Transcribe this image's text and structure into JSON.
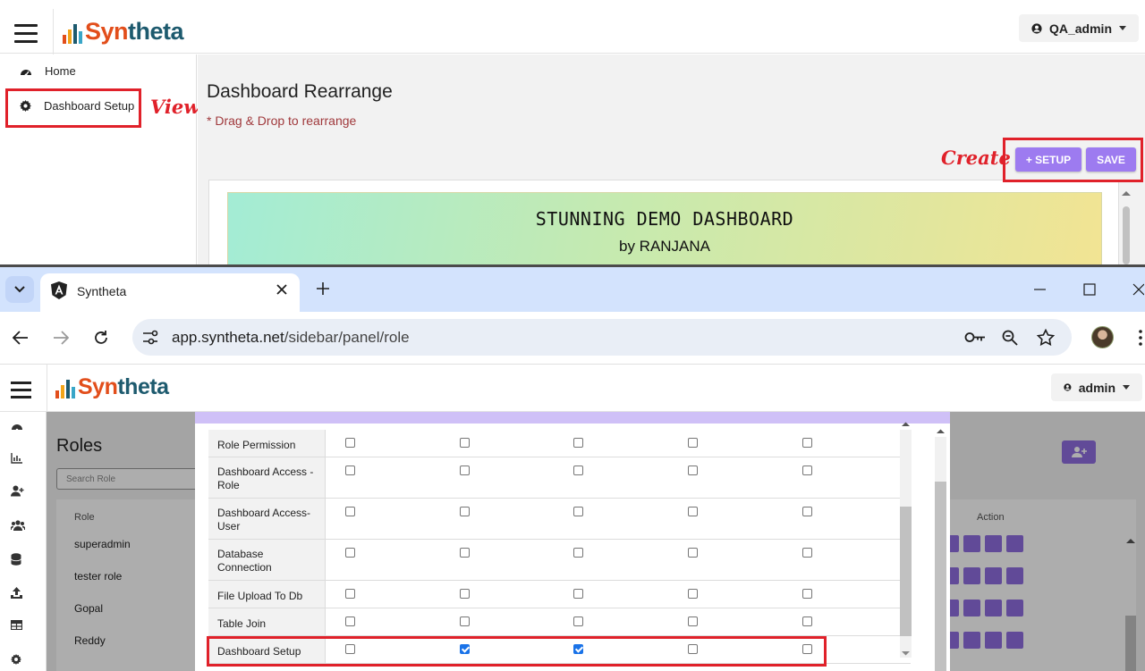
{
  "top_app": {
    "logo": {
      "part1": "Syn",
      "part2": "theta"
    },
    "user": "QA_admin",
    "sidebar": [
      {
        "label": "Home",
        "icon": "dashboard-gauge-icon"
      },
      {
        "label": "Dashboard Setup",
        "icon": "gear-icon"
      }
    ],
    "annotation_view": "View",
    "annotation_create": "Create",
    "page_title": "Dashboard Rearrange",
    "hint": "* Drag & Drop to rearrange",
    "buttons": {
      "setup": "+ SETUP",
      "save": "SAVE"
    },
    "banner": {
      "title": "STUNNING DEMO DASHBOARD",
      "subtitle": "by RANJANA"
    }
  },
  "browser": {
    "tab_title": "Syntheta",
    "url_host": "app.syntheta.net",
    "url_path": "/sidebar/panel/role"
  },
  "bottom_app": {
    "logo": {
      "part1": "Syn",
      "part2": "theta"
    },
    "user": "admin",
    "page_title": "Roles",
    "search_placeholder": "Search Role",
    "table_headers": {
      "role": "Role",
      "action": "Action"
    },
    "roles": [
      "superadmin",
      "tester role",
      "Gopal",
      "Reddy"
    ],
    "sidebar_icons": [
      "dashboard-gauge-icon",
      "chart-icon",
      "user-icon",
      "users-icon",
      "database-icon",
      "upload-icon",
      "table-icon",
      "gear-icon"
    ],
    "permissions_modal": {
      "rows": [
        {
          "label": "Role Permission",
          "checks": [
            false,
            false,
            false,
            false,
            false
          ]
        },
        {
          "label": "Dashboard Access - Role",
          "checks": [
            false,
            false,
            false,
            false,
            false
          ]
        },
        {
          "label": "Dashboard Access-User",
          "checks": [
            false,
            false,
            false,
            false,
            false
          ]
        },
        {
          "label": "Database Connection",
          "checks": [
            false,
            false,
            false,
            false,
            false
          ]
        },
        {
          "label": "File Upload To Db",
          "checks": [
            false,
            false,
            false,
            false,
            false
          ]
        },
        {
          "label": "Table Join",
          "checks": [
            false,
            false,
            false,
            false,
            false
          ]
        },
        {
          "label": "Dashboard Setup",
          "checks": [
            false,
            true,
            true,
            false,
            false
          ]
        }
      ]
    }
  },
  "colors": {
    "accent": "#9d7bf0",
    "highlight": "#e0212a",
    "tabbar": "#d3e3fd"
  }
}
